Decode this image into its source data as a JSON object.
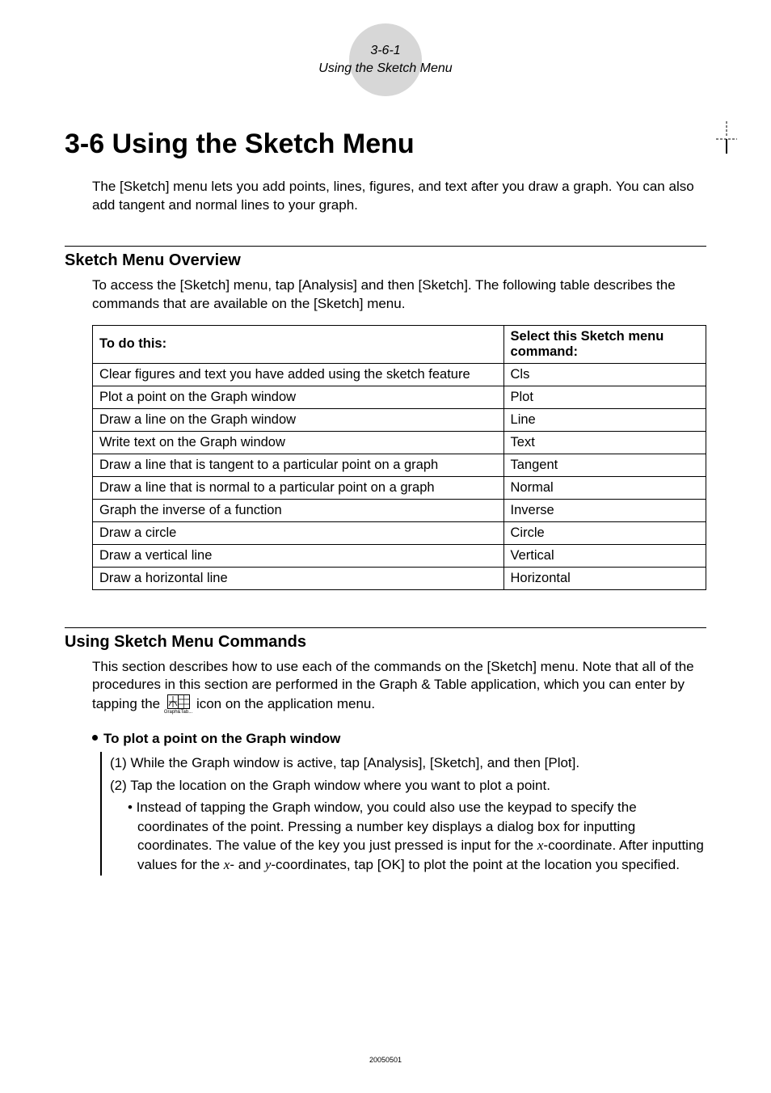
{
  "badge": {
    "num": "3-6-1",
    "title": "Using the Sketch Menu"
  },
  "h1": "3-6  Using the Sketch Menu",
  "intro": "The [Sketch] menu lets you add points, lines, figures, and text after you draw a graph. You can also add tangent and normal lines to your graph.",
  "overview": {
    "heading": "Sketch Menu Overview",
    "desc": "To access the [Sketch] menu, tap [Analysis] and then [Sketch]. The following table describes the commands that are available on the [Sketch] menu.",
    "th1": "To do this:",
    "th2": "Select this Sketch menu command:",
    "rows": [
      {
        "a": "Clear figures and text you have added using the sketch feature",
        "b": "Cls"
      },
      {
        "a": "Plot a point on the Graph window",
        "b": "Plot"
      },
      {
        "a": "Draw a line on the Graph window",
        "b": "Line"
      },
      {
        "a": "Write text on the Graph window",
        "b": "Text"
      },
      {
        "a": "Draw a line that is tangent to a particular point on a graph",
        "b": "Tangent"
      },
      {
        "a": "Draw a line that is normal to a particular point on a graph",
        "b": "Normal"
      },
      {
        "a": "Graph the inverse of a function",
        "b": "Inverse"
      },
      {
        "a": "Draw a circle",
        "b": "Circle"
      },
      {
        "a": "Draw a vertical line",
        "b": "Vertical"
      },
      {
        "a": "Draw a horizontal line",
        "b": "Horizontal"
      }
    ]
  },
  "commands": {
    "heading": "Using Sketch Menu Commands",
    "desc_a": "This section describes how to use each of the commands on the [Sketch] menu. Note that all of the procedures in this section are performed in the Graph & Table application, which you can enter by tapping the ",
    "desc_b": " icon on the application menu.",
    "icon_label": "Graph&Tab...",
    "proc_heading": "To plot a point on the Graph window",
    "step1": "(1) While the Graph window is active, tap [Analysis], [Sketch], and then [Plot].",
    "step2": "(2) Tap the location on the Graph window where you want to plot a point.",
    "sub_a": "• Instead of tapping the Graph window, you could also use the keypad to specify the coordinates of the point. Pressing a number key displays a dialog box for inputting coordinates. The value of the key you just pressed is input for the ",
    "sub_b": "-coordinate. After inputting values for the ",
    "sub_c": "- and ",
    "sub_d": "-coordinates, tap [OK] to plot the point at the location you specified.",
    "x": "x",
    "y": "y"
  },
  "footer": "20050501"
}
